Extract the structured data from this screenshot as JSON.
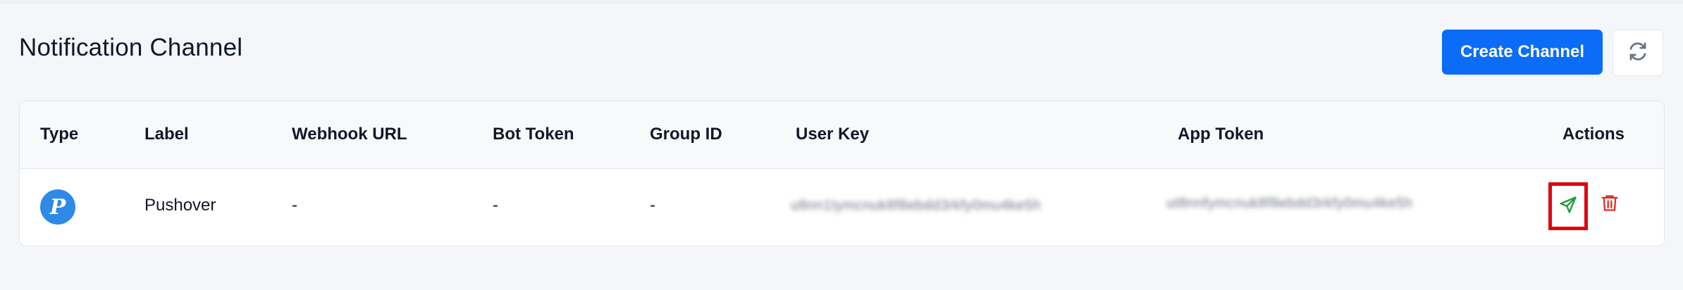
{
  "page": {
    "title": "Notification Channel"
  },
  "toolbar": {
    "create_label": "Create Channel",
    "refresh_icon": "refresh-icon"
  },
  "table": {
    "columns": [
      "Type",
      "Label",
      "Webhook URL",
      "Bot Token",
      "Group ID",
      "User Key",
      "App Token",
      "Actions"
    ],
    "rows": [
      {
        "type_icon": "pushover-icon",
        "label": "Pushover",
        "webhook_url": "-",
        "bot_token": "-",
        "group_id": "-",
        "user_key": "u8nn1tymcnuk8f8ebdd3rkfy0mu4ke5h",
        "app_token": "ut8nnfymcnuk8f8ebdd3rkfy0mu4ke5h",
        "actions": [
          "send-test-icon",
          "trash-icon"
        ]
      }
    ]
  },
  "colors": {
    "primary": "#0b6cf7",
    "pushover": "#2e8ae6",
    "send_action": "#1f9d3a",
    "delete_action": "#d93025",
    "highlight": "#e0070f"
  }
}
